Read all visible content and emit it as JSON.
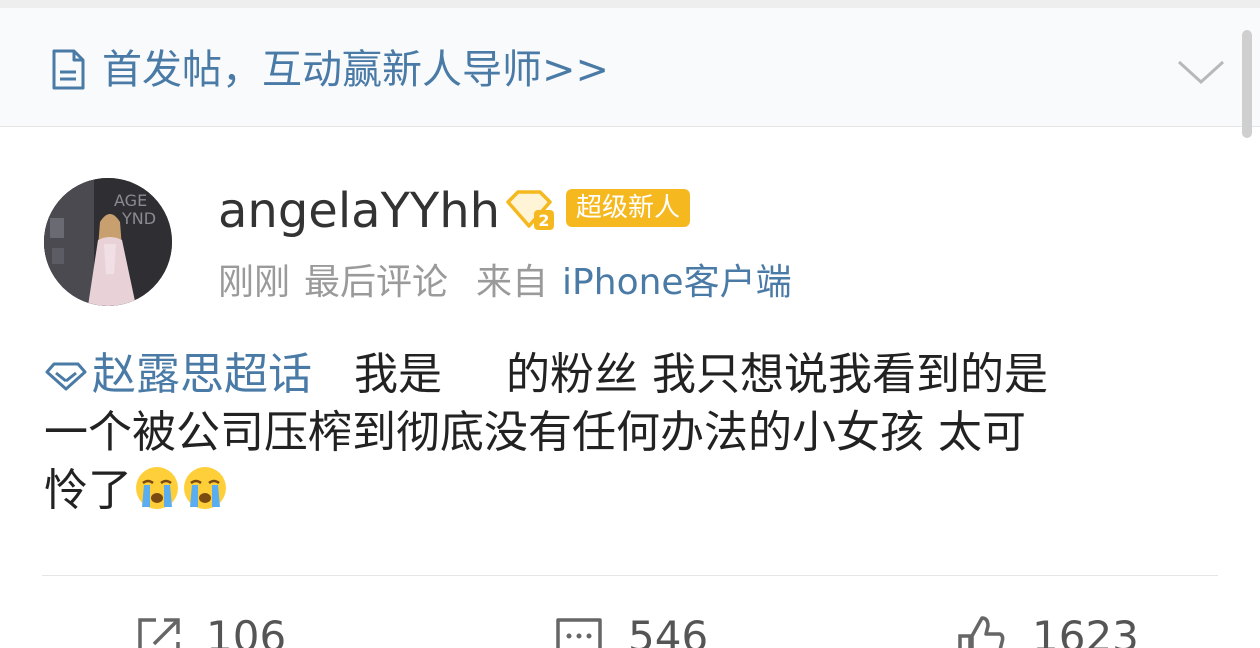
{
  "banner": {
    "text": "首发帖，互动赢新人导师>>",
    "icon": "document-icon",
    "collapse_icon": "chevron-down-icon"
  },
  "post": {
    "author": {
      "name": "angelaYYhh",
      "vip_icon": "diamond-vip-icon",
      "badge": "超级新人"
    },
    "meta": {
      "time": "刚刚",
      "action": "最后评论",
      "from_label": "来自",
      "client": "iPhone客户端"
    },
    "content": {
      "topic": "赵露思超话",
      "line1": "我是",
      "line1_b": "的粉丝 我只想说我看到的是",
      "line2": "一个被公司压榨到彻底没有任何办法的小女孩 太可",
      "line3": "怜了",
      "emoji": [
        "crying-face-emoji",
        "crying-face-emoji"
      ]
    },
    "actions": {
      "repost": "106",
      "comment": "546",
      "like": "1623"
    }
  },
  "colors": {
    "link": "#4a7aa6",
    "badge": "#f5b81f",
    "meta_gray": "#9a9a9a"
  }
}
